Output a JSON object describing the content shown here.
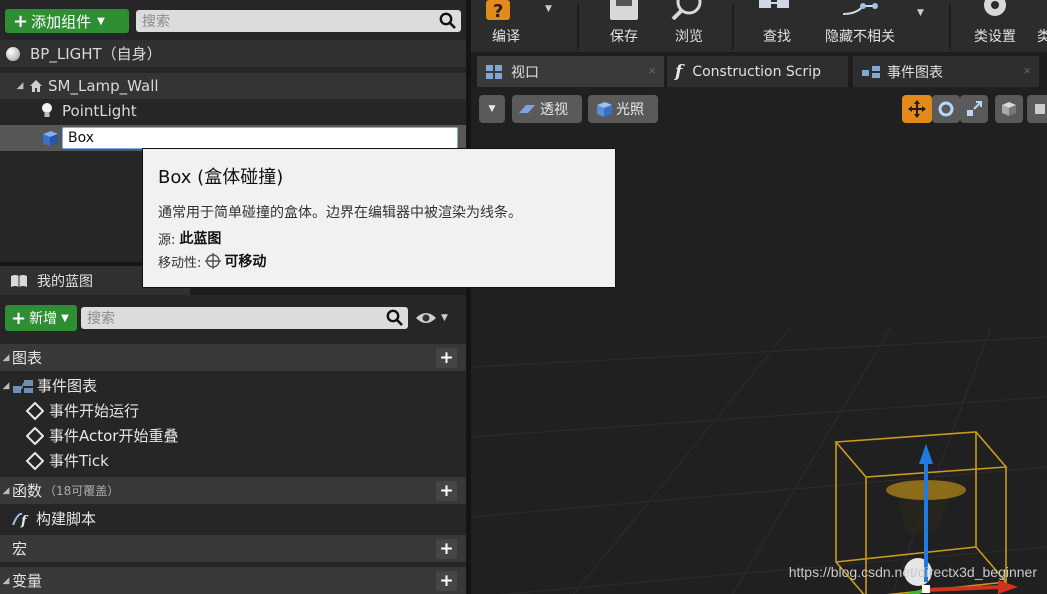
{
  "components": {
    "add_button_label": "添加组件",
    "search_placeholder": "搜索",
    "root_item": "BP_LIGHT（自身）",
    "tree": [
      {
        "label": "SM_Lamp_Wall"
      },
      {
        "label": "PointLight"
      },
      {
        "label": "Box"
      }
    ]
  },
  "tooltip": {
    "title": "Box (盒体碰撞)",
    "description": "通常用于简单碰撞的盒体。边界在编辑器中被渲染为线条。",
    "source_key": "源:",
    "source_value": "此蓝图",
    "mobility_key": "移动性:",
    "mobility_value": "可移动"
  },
  "my_blueprint": {
    "tab_label": "我的蓝图",
    "new_button_label": "新增",
    "search_placeholder": "搜索",
    "graphs_label": "图表",
    "event_graph_label": "事件图表",
    "events": [
      "事件开始运行",
      "事件Actor开始重叠",
      "事件Tick"
    ],
    "functions_label": "函数",
    "functions_count": "（18可覆盖）",
    "construction_script_label": "构建脚本",
    "macros_label": "宏",
    "variables_label": "变量"
  },
  "toolbar": {
    "compile": "编译",
    "save": "保存",
    "browse": "浏览",
    "find": "查找",
    "hide_unrelated": "隐藏不相关",
    "class_settings": "类设置",
    "class_defaults_partial": "类"
  },
  "tabs": [
    {
      "label": "视口"
    },
    {
      "label": "Construction Scrip"
    },
    {
      "label": "事件图表"
    }
  ],
  "viewport": {
    "perspective_label": "透视",
    "lit_label": "光照"
  },
  "watermark": "https://blog.csdn.net/directx3d_beginner",
  "colors": {
    "green_button": "#2f8d34",
    "gizmo_up": "#1f7be0",
    "gizmo_right": "#d0331e",
    "gizmo_forward": "#4bb233",
    "bounding_box": "#c89a1e"
  }
}
